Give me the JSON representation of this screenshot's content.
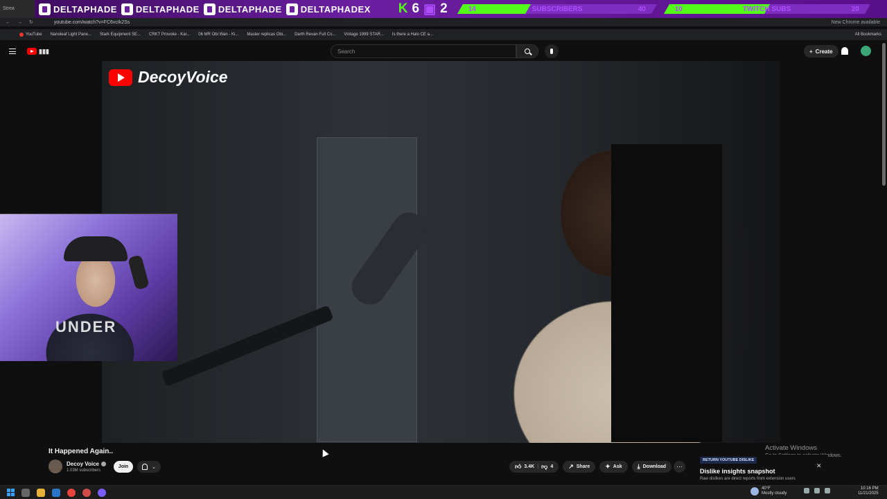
{
  "stream_overlay": {
    "tab_stub": "Strea",
    "socials": [
      {
        "icon": "twitch-icon",
        "handle": "DELTAPHADE"
      },
      {
        "icon": "instagram-icon",
        "handle": "DELTAPHADE"
      },
      {
        "icon": "youtube-icon",
        "handle": "DELTAPHADE"
      },
      {
        "icon": "twitter-icon",
        "handle": "DELTAPHADEX"
      }
    ],
    "kick_count": "6",
    "twitch_count": "2",
    "goals": [
      {
        "current": "14",
        "label": "SUBSCRIBERS",
        "target": "40",
        "progress": 0.35
      },
      {
        "current": "10",
        "label": "TWITCH SUBS",
        "target": "20",
        "progress": 0.5
      }
    ],
    "colors": {
      "kick": "#53fc18",
      "bar": "#6b1fa0"
    }
  },
  "browser": {
    "url": "youtube.com/watch?v=FC6vcIk2Ss",
    "notice": "New Chrome available",
    "bookmarks": [
      "YouTube",
      "Nanoleaf Light Pane...",
      "Stark Equipment SE...",
      "CRKT Provoke - Kar...",
      "06 MR Obi Wan - Ki...",
      "Master replicas Obi...",
      "Darth Revan Full Co...",
      "Vintage 1999 STAR...",
      "Is there a Halo CE a..."
    ],
    "all_bookmarks": "All Bookmarks"
  },
  "youtube": {
    "search_placeholder": "Search",
    "create_label": "Create",
    "accent": "#ff0000"
  },
  "video": {
    "watermark": "DecoyVoice",
    "title": "It Happened Again..",
    "channel": "Decoy Voice",
    "subscribers": "1.03M subscribers",
    "join_label": "Join",
    "likes": "3.4K",
    "dislikes": "4",
    "share_label": "Share",
    "ask_label": "Ask",
    "download_label": "Download"
  },
  "webcam": {
    "shirt_text": "UNDER"
  },
  "ryd_card": {
    "tag": "RETURN YOUTUBE DISLIKE",
    "title": "Dislike insights snapshot",
    "subtitle": "Raw dislikes are direct reports from extension users"
  },
  "windows": {
    "activate_title": "Activate Windows",
    "activate_sub": "Go to Settings to activate Windows.",
    "temp": "40°F",
    "weather": "Mostly cloudy",
    "time": "10:16 PM",
    "date": "11/21/2025"
  }
}
